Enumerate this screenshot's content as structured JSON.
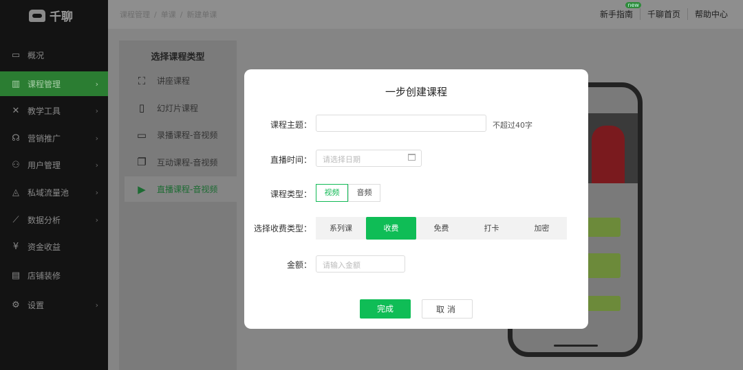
{
  "brand": "千聊",
  "sidebar": {
    "items": [
      {
        "label": "概况",
        "icon": "monitor-icon",
        "glyph": "▭",
        "chev": false
      },
      {
        "label": "课程管理",
        "icon": "book-icon",
        "glyph": "▥",
        "chev": true,
        "active": true
      },
      {
        "label": "教学工具",
        "icon": "tools-icon",
        "glyph": "✕",
        "chev": true
      },
      {
        "label": "营销推广",
        "icon": "megaphone-icon",
        "glyph": "☊",
        "chev": true
      },
      {
        "label": "用户管理",
        "icon": "users-icon",
        "glyph": "⚇",
        "chev": true
      },
      {
        "label": "私域流量池",
        "icon": "drop-icon",
        "glyph": "◬",
        "chev": true
      },
      {
        "label": "数据分析",
        "icon": "chart-icon",
        "glyph": "⟋",
        "chev": true
      },
      {
        "label": "资金收益",
        "icon": "yen-icon",
        "glyph": "¥",
        "chev": false
      },
      {
        "label": "店铺装修",
        "icon": "shop-icon",
        "glyph": "▤",
        "chev": false
      },
      {
        "label": "设置",
        "icon": "gear-icon",
        "glyph": "⚙",
        "chev": true
      }
    ]
  },
  "breadcrumb": [
    "课程管理",
    "/",
    "单课",
    "/",
    "新建单课"
  ],
  "toplinks": {
    "guide": "新手指南",
    "badge": "new",
    "home": "千聊首页",
    "help": "帮助中心"
  },
  "panel": {
    "title": "选择课程类型",
    "items": [
      {
        "label": "讲座课程",
        "glyph": "⛶"
      },
      {
        "label": "幻灯片课程",
        "glyph": "▯"
      },
      {
        "label": "录播课程-音视频",
        "glyph": "▭"
      },
      {
        "label": "互动课程-音视频",
        "glyph": "❐"
      },
      {
        "label": "直播课程-音视频",
        "glyph": "▶",
        "active": true
      }
    ]
  },
  "modal": {
    "title": "一步创建课程",
    "topic_label": "课程主题：",
    "topic_value": "",
    "topic_hint": "不超过40字",
    "time_label": "直播时间：",
    "time_placeholder": "请选择日期",
    "type_label": "课程类型：",
    "type_options": [
      "视频",
      "音频"
    ],
    "fee_label": "选择收费类型：",
    "fee_options": [
      "系列课",
      "收费",
      "免费",
      "打卡",
      "加密"
    ],
    "amount_label": "金额：",
    "amount_placeholder": "请输入金额",
    "ok": "完成",
    "cancel": "取消"
  },
  "colors": {
    "accent": "#0fbd56"
  }
}
